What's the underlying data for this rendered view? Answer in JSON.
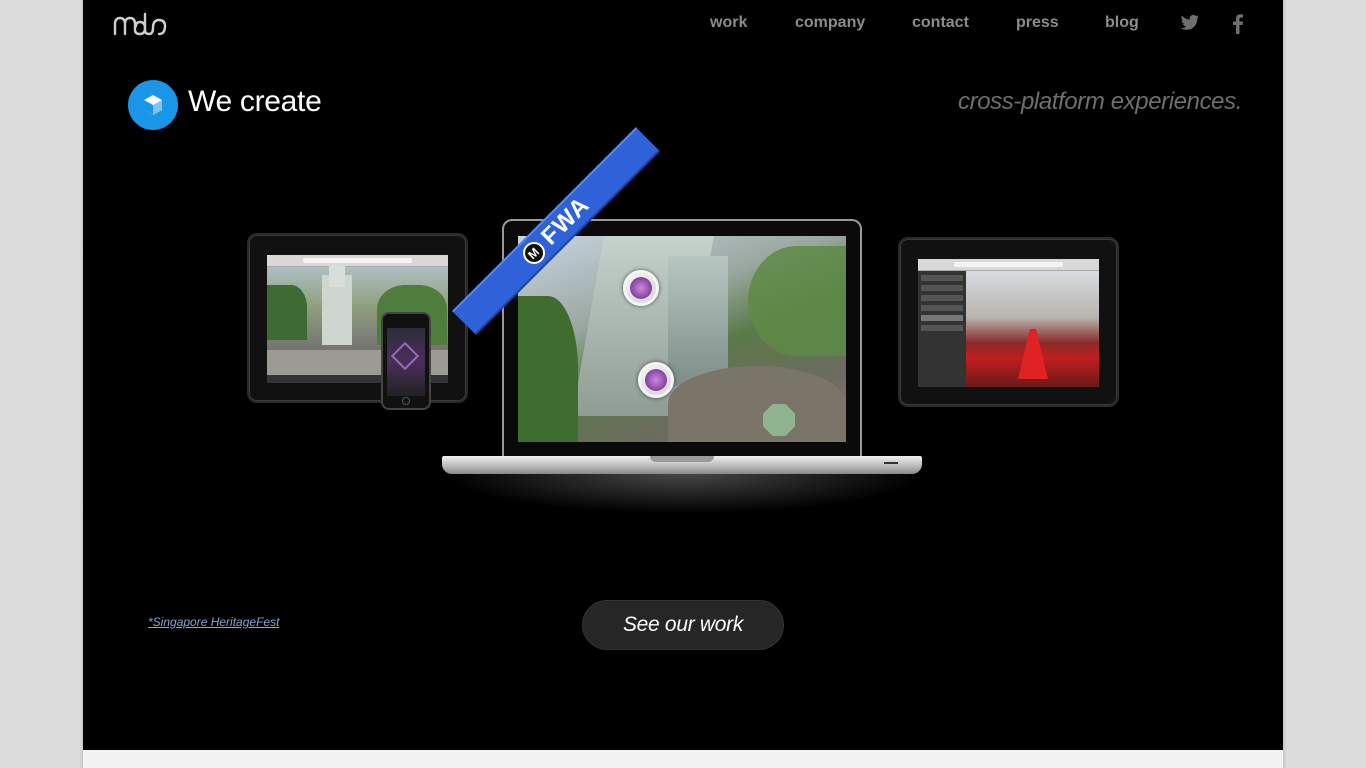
{
  "brand": {
    "logo_icon": "mdr-logo"
  },
  "nav": {
    "items": [
      {
        "label": "work"
      },
      {
        "label": "company"
      },
      {
        "label": "contact"
      },
      {
        "label": "press"
      },
      {
        "label": "blog"
      }
    ],
    "social": [
      "twitter-icon",
      "facebook-icon"
    ]
  },
  "hero": {
    "title": "We create",
    "tagline": "cross-platform experiences.",
    "icon": "cube-icon",
    "accent_color": "#1a96e8"
  },
  "showcase": {
    "ribbon_text": "FWA",
    "ribbon_color": "#2f62d8",
    "caption": "*Singapore HeritageFest"
  },
  "cta": {
    "label": "See our work"
  },
  "colors": {
    "page_bg": "#000000",
    "outer_bg": "#dcdcdc",
    "nav_text": "#8c8c8c"
  }
}
